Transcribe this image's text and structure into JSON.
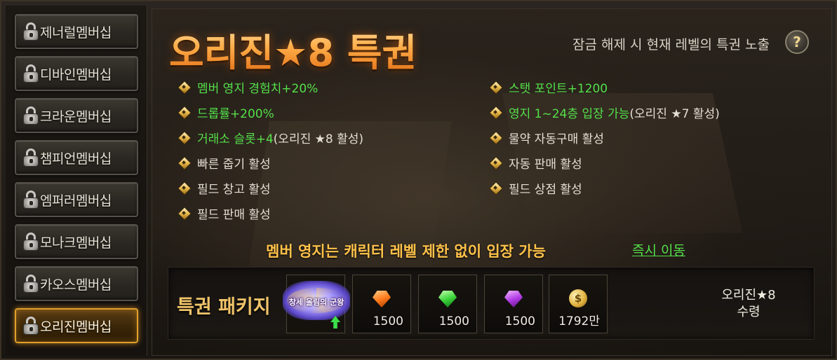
{
  "sidebar": {
    "items": [
      {
        "label": "제너럴멤버십"
      },
      {
        "label": "디바인멤버십"
      },
      {
        "label": "크라운멤버십"
      },
      {
        "label": "챔피언멤버십"
      },
      {
        "label": "엠퍼러멤버십"
      },
      {
        "label": "모나크멤버십"
      },
      {
        "label": "카오스멤버십"
      },
      {
        "label": "오리진멤버십",
        "active": true
      }
    ]
  },
  "header": {
    "title": "오리진★8 특권",
    "unlock_note": "잠금 해제 시 현재 레벨의 특권 노출",
    "help_label": "?"
  },
  "perks": {
    "left": [
      {
        "text": "멤버 영지 경험치+20%",
        "highlight": true
      },
      {
        "text": "드롭률+200%",
        "highlight": true
      },
      {
        "text": "거래소 슬롯+4",
        "suffix": "(오리진 ★8 활성)",
        "highlight": true
      },
      {
        "text": "빠른 줍기 활성"
      },
      {
        "text": "필드 창고 활성"
      },
      {
        "text": "필드 판매 활성"
      }
    ],
    "right": [
      {
        "text": "스탯 포인트+1200",
        "highlight": true
      },
      {
        "text": "영지 1~24층 입장 가능",
        "suffix": "(오리진 ★7 활성)",
        "highlight": true
      },
      {
        "text": "물약 자동구매 활성"
      },
      {
        "text": "자동 판매 활성"
      },
      {
        "text": "필드 상점 활성"
      }
    ]
  },
  "member_note": "멤버 영지는 캐릭터 레벨 제한 없이 입장 가능",
  "move_link": "즉시 이동",
  "package": {
    "label": "특권 패키지",
    "badge_text": "창세 올림의 군왕",
    "items": [
      {
        "icon": "orange-gem-icon",
        "qty": "1500"
      },
      {
        "icon": "green-gem-icon",
        "qty": "1500"
      },
      {
        "icon": "purple-gem-icon",
        "qty": "1500"
      },
      {
        "icon": "gold-coin-icon",
        "qty": "1792만"
      }
    ],
    "receive_line1": "오리진★8",
    "receive_line2": "수령"
  },
  "colors": {
    "accent": "#ffb55a",
    "highlight_green": "#54e04a",
    "note_gold": "#ffc24a"
  }
}
